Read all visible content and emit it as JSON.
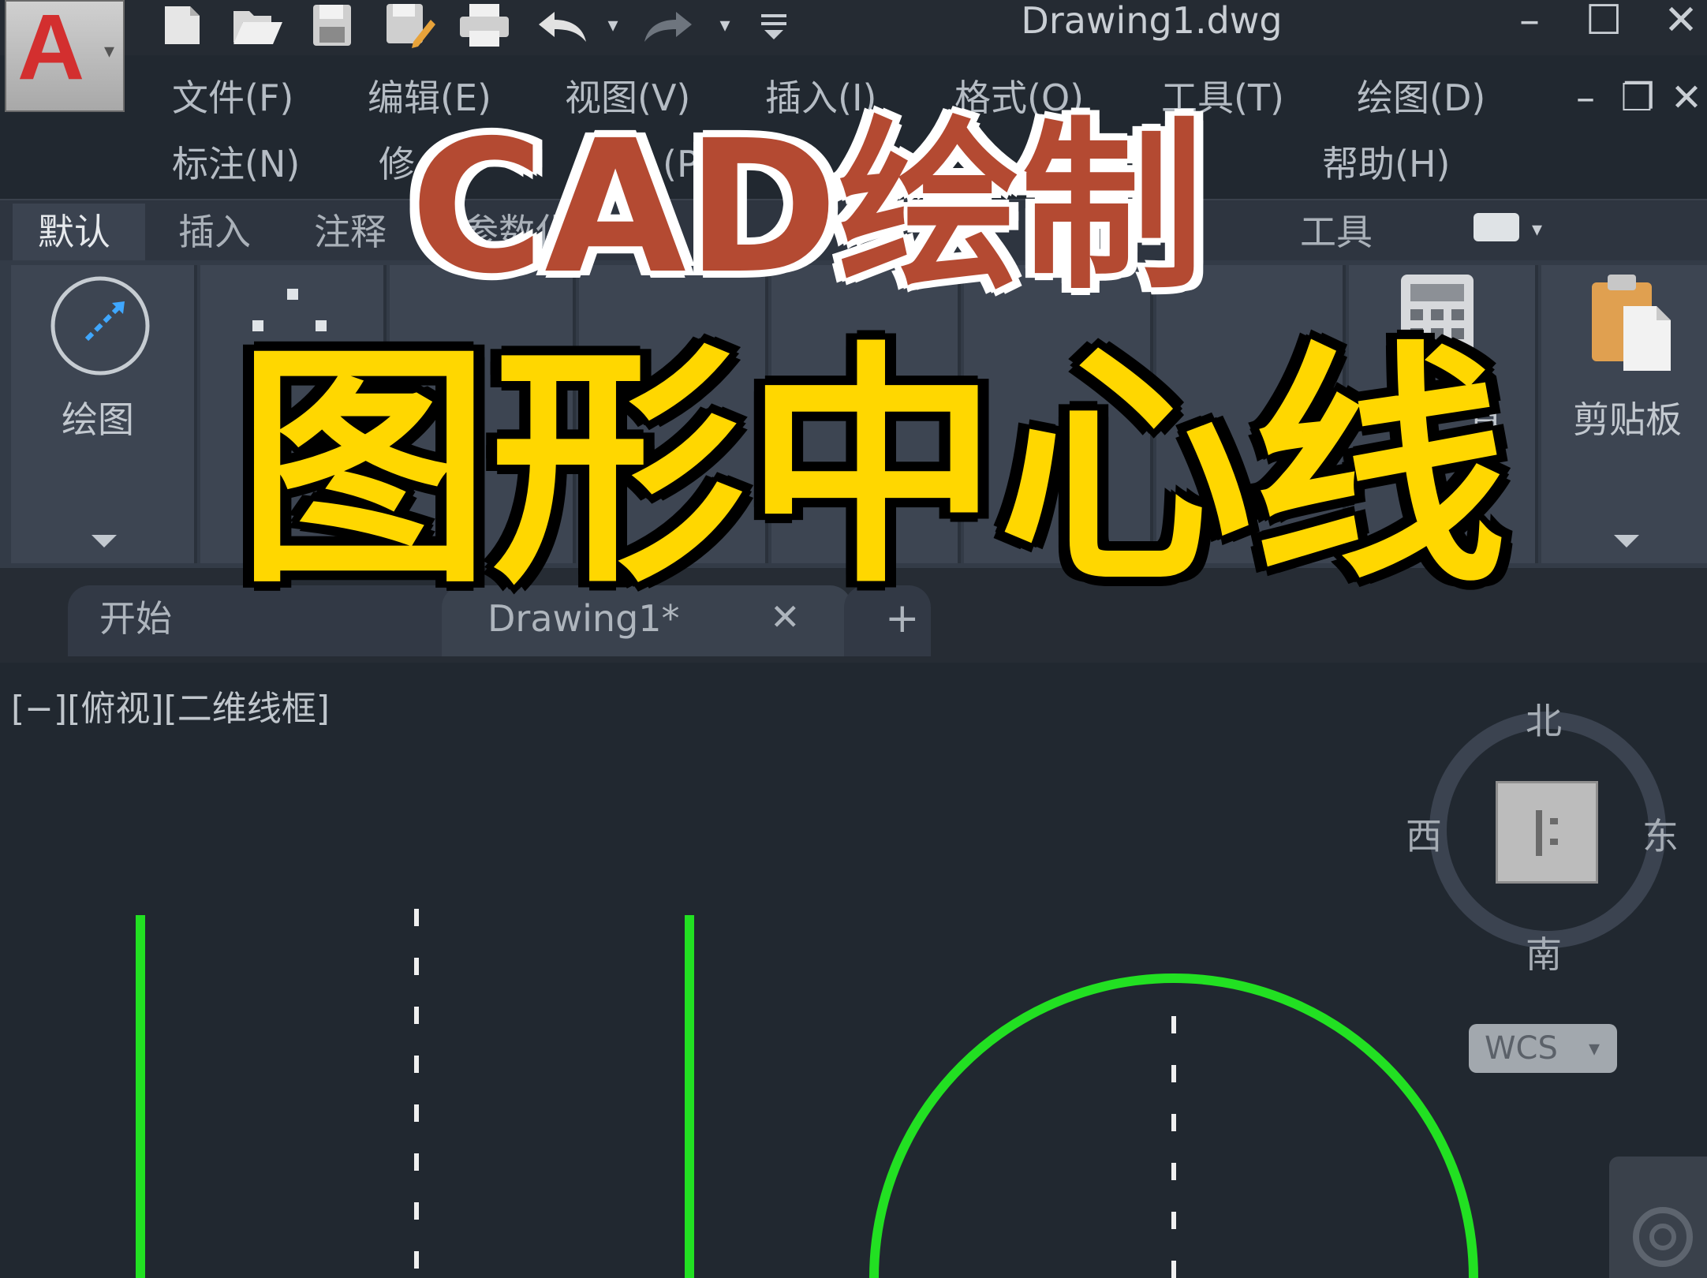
{
  "window": {
    "title": "Drawing1.dwg",
    "minimize_icon": "minimize-icon",
    "maximize_icon": "maximize-icon",
    "close_icon": "close-icon"
  },
  "app_menu": {
    "logo_letter": "A",
    "icon": "autocad-logo-icon"
  },
  "quick_access": [
    {
      "name": "new-file-icon"
    },
    {
      "name": "open-folder-icon"
    },
    {
      "name": "save-icon"
    },
    {
      "name": "save-as-icon"
    },
    {
      "name": "print-icon"
    },
    {
      "name": "undo-icon"
    },
    {
      "name": "redo-icon"
    },
    {
      "name": "customize-qat-icon"
    }
  ],
  "menubar": {
    "row1": [
      "文件(F)",
      "编辑(E)",
      "视图(V)",
      "插入(I)",
      "格式(O)",
      "工具(T)",
      "绘图(D)"
    ],
    "row2": [
      "标注(N)",
      "修",
      "(P",
      "帮助(H)"
    ]
  },
  "ribbon_tabs": [
    "默认",
    "插入",
    "注释",
    "参数化",
    "工具"
  ],
  "ribbon_panels": {
    "draw_label": "绘图",
    "partial_label_1": "具",
    "clipboard_label": "剪贴板"
  },
  "doc_tabs": {
    "start_label": "开始",
    "drawing_label": "Drawing1*",
    "close_symbol": "✕",
    "new_symbol": "+"
  },
  "viewport": {
    "label": "[−][俯视][二维线框]",
    "compass": {
      "north": "北",
      "west": "西",
      "east": "东",
      "south": "南"
    },
    "wcs_label": "WCS"
  },
  "overlay": {
    "headline_1": "CAD绘制",
    "headline_2": "图形中心线"
  },
  "colors": {
    "geometry": "#22e022",
    "centerline": "#f0f0f0",
    "headline_1": "#b44a32",
    "headline_2": "#ffd700"
  }
}
